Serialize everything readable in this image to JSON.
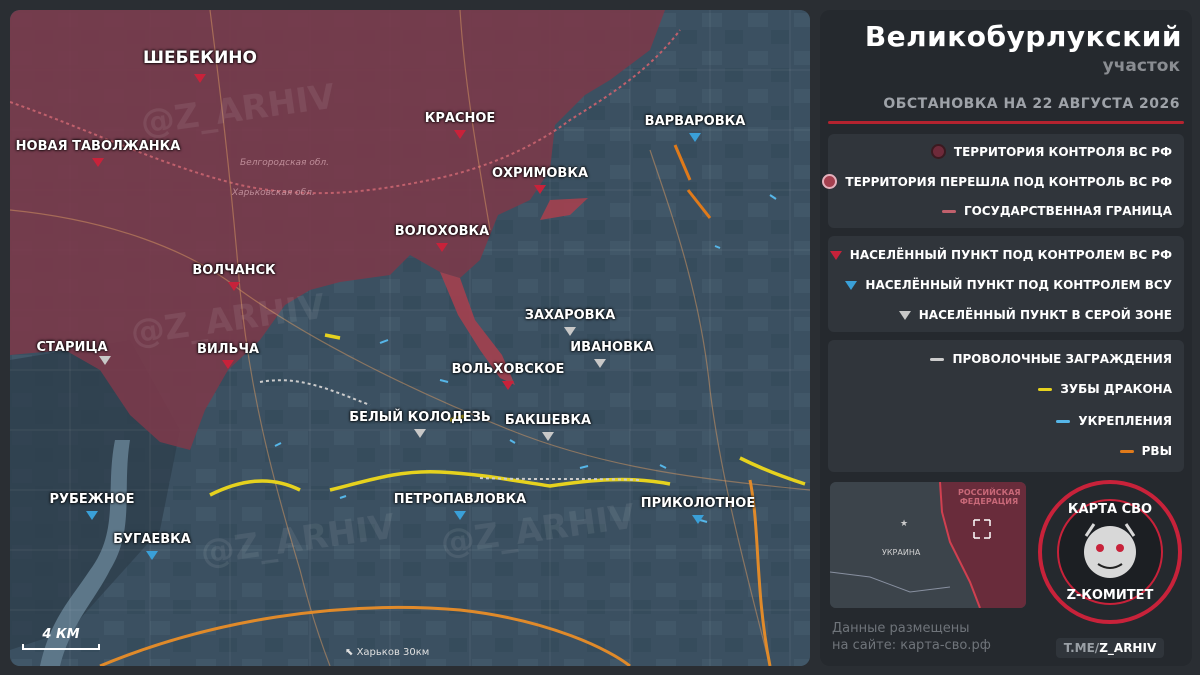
{
  "map": {
    "cities": {
      "shebekino": "ШЕБЕКИНО",
      "novaya_tavolzhanka": "НОВАЯ ТАВОЛЖАНКА",
      "krasnoe": "КРАСНОЕ",
      "varvarovka": "ВАРВАРОВКА",
      "okhrimovka": "ОХРИМОВКА",
      "volokhovka": "ВОЛОХОВКА",
      "volchansk": "ВОЛЧАНСК",
      "zakharovka": "ЗАХАРОВКА",
      "ivanovka": "ИВАНОВКА",
      "staritsa": "СТАРИЦА",
      "vilcha": "ВИЛЬЧА",
      "volkhovskoe": "ВОЛЬХОВСКОЕ",
      "bely_kolodez": "БЕЛЫЙ КОЛОДЕЗЬ",
      "bakshevka": "БАКШЕВКА",
      "rubezhnoe": "РУБЕЖНОЕ",
      "petropavlovka": "ПЕТРОПАВЛОВКА",
      "prikolotnoe": "ПРИКОЛОТНОЕ",
      "bugaevka": "БУГАЕВКА"
    },
    "region_labels": {
      "belgorod": "Белгородская обл.",
      "kharkov": "Харьковская обл."
    },
    "watermark": "@Z_ARHIV",
    "scale_label": "4 КМ",
    "direction_note": "Харьков 30км"
  },
  "panel": {
    "title": "Великобурлукский",
    "subtitle": "участок",
    "date_line": "ОБСТАНОВКА  НА 22 АВГУСТА 2026",
    "legend_territory": [
      "ТЕРРИТОРИЯ КОНТРОЛЯ ВС РФ",
      "ТЕРРИТОРИЯ ПЕРЕШЛА ПОД КОНТРОЛЬ ВС РФ",
      "ГОСУДАРСТВЕННАЯ ГРАНИЦА"
    ],
    "legend_settlements": [
      "НАСЕЛЁННЫЙ ПУНКТ ПОД КОНТРОЛЕМ ВС РФ",
      "НАСЕЛЁННЫЙ ПУНКТ ПОД КОНТРОЛЕМ ВСУ",
      "НАСЕЛЁННЫЙ ПУНКТ В СЕРОЙ ЗОНЕ"
    ],
    "legend_fortifications": [
      "ПРОВОЛОЧНЫЕ ЗАГРАЖДЕНИЯ",
      "ЗУБЫ ДРАКОНА",
      "УКРЕПЛЕНИЯ",
      "РВЫ"
    ],
    "inset": {
      "russia_label": "РОССИЙСКАЯ ФЕДЕРАЦИЯ",
      "ukraine_label": "УКРАИНА"
    },
    "emblem_top": "КАРТА СВО",
    "emblem_bottom": "Z-КОМИТЕТ",
    "site_note_line1": "Данные размещены",
    "site_note_line2": "на сайте: карта-сво.рф",
    "channel_prefix": "T.ME/",
    "channel_main": "Z_ARHIV"
  },
  "colors": {
    "ru_territory": "#7a3a4a",
    "ua_marker": "#3aa0d8",
    "ru_marker": "#c8223a",
    "grey_marker": "#c8c8c8",
    "wire": "#cccccc",
    "dragon_teeth": "#e6d21e",
    "fortification": "#56b6e8",
    "ditch": "#e07a1a",
    "border": "#c0606c"
  }
}
